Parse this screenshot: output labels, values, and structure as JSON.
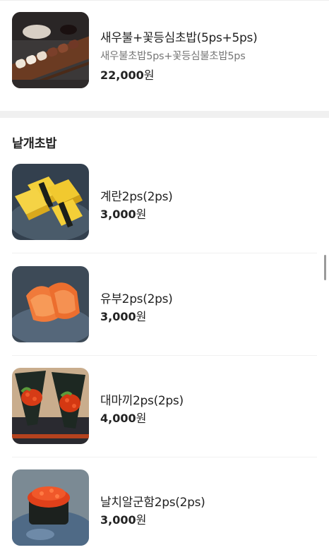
{
  "top_item": {
    "name": "새우불+꽃등심초밥(5ps+5ps)",
    "description": "새우불초밥5ps+꽃등심불초밥5ps",
    "price": "22,000",
    "currency": "원"
  },
  "section": {
    "title": "낱개초밥",
    "items": [
      {
        "name": "계란2ps(2ps)",
        "price": "3,000",
        "currency": "원"
      },
      {
        "name": "유부2ps(2ps)",
        "price": "3,000",
        "currency": "원"
      },
      {
        "name": "대마끼2ps(2ps)",
        "price": "4,000",
        "currency": "원"
      },
      {
        "name": "날치알군함2ps(2ps)",
        "price": "3,000",
        "currency": "원"
      }
    ]
  },
  "colors": {
    "text": "#222222",
    "description": "#777777",
    "divider": "#f0f0f0"
  }
}
